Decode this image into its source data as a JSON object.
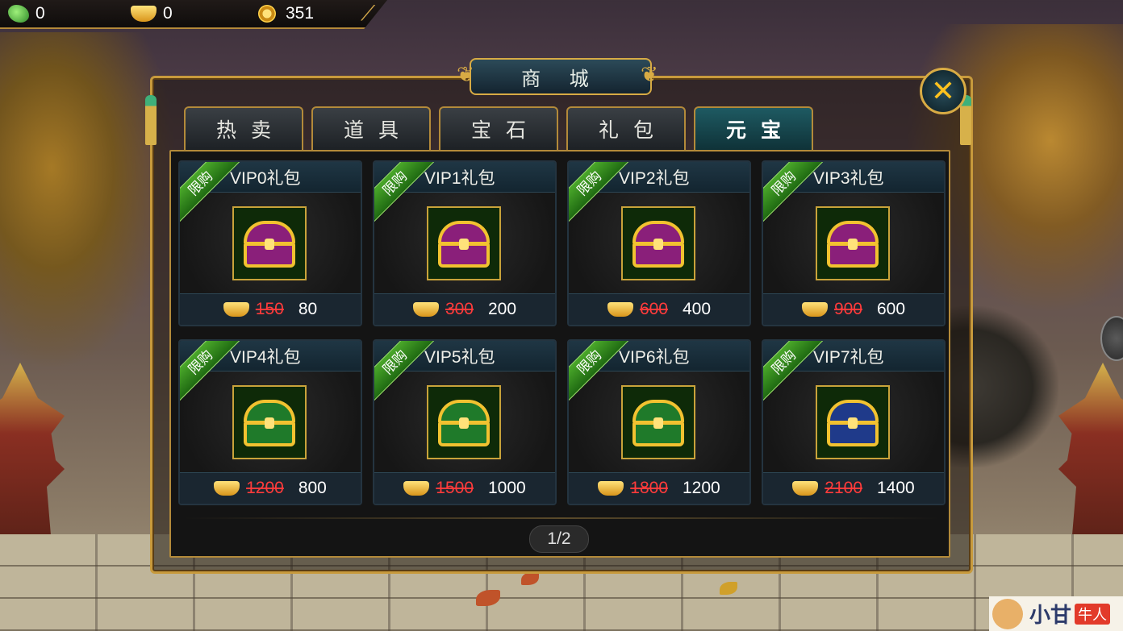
{
  "resources": {
    "jade": "0",
    "ingot": "0",
    "coin": "351"
  },
  "title": "商 城",
  "tabs": [
    {
      "label": "热卖",
      "active": false
    },
    {
      "label": "道具",
      "active": false
    },
    {
      "label": "宝石",
      "active": false
    },
    {
      "label": "礼包",
      "active": false
    },
    {
      "label": "元宝",
      "active": true
    }
  ],
  "items": [
    {
      "name": "VIP0礼包",
      "badge": "限购",
      "old_price": "150",
      "price": "80",
      "chest_color": "#8a1f7a"
    },
    {
      "name": "VIP1礼包",
      "badge": "限购",
      "old_price": "300",
      "price": "200",
      "chest_color": "#8a1f7a"
    },
    {
      "name": "VIP2礼包",
      "badge": "限购",
      "old_price": "600",
      "price": "400",
      "chest_color": "#8a1f7a"
    },
    {
      "name": "VIP3礼包",
      "badge": "限购",
      "old_price": "900",
      "price": "600",
      "chest_color": "#8a1f7a"
    },
    {
      "name": "VIP4礼包",
      "badge": "限购",
      "old_price": "1200",
      "price": "800",
      "chest_color": "#1f7a2a"
    },
    {
      "name": "VIP5礼包",
      "badge": "限购",
      "old_price": "1500",
      "price": "1000",
      "chest_color": "#1f7a2a"
    },
    {
      "name": "VIP6礼包",
      "badge": "限购",
      "old_price": "1800",
      "price": "1200",
      "chest_color": "#1f7a2a"
    },
    {
      "name": "VIP7礼包",
      "badge": "限购",
      "old_price": "2100",
      "price": "1400",
      "chest_color": "#1f3a8a"
    }
  ],
  "pager": "1/2",
  "watermark": {
    "text": "小甘",
    "badge": "牛人"
  }
}
